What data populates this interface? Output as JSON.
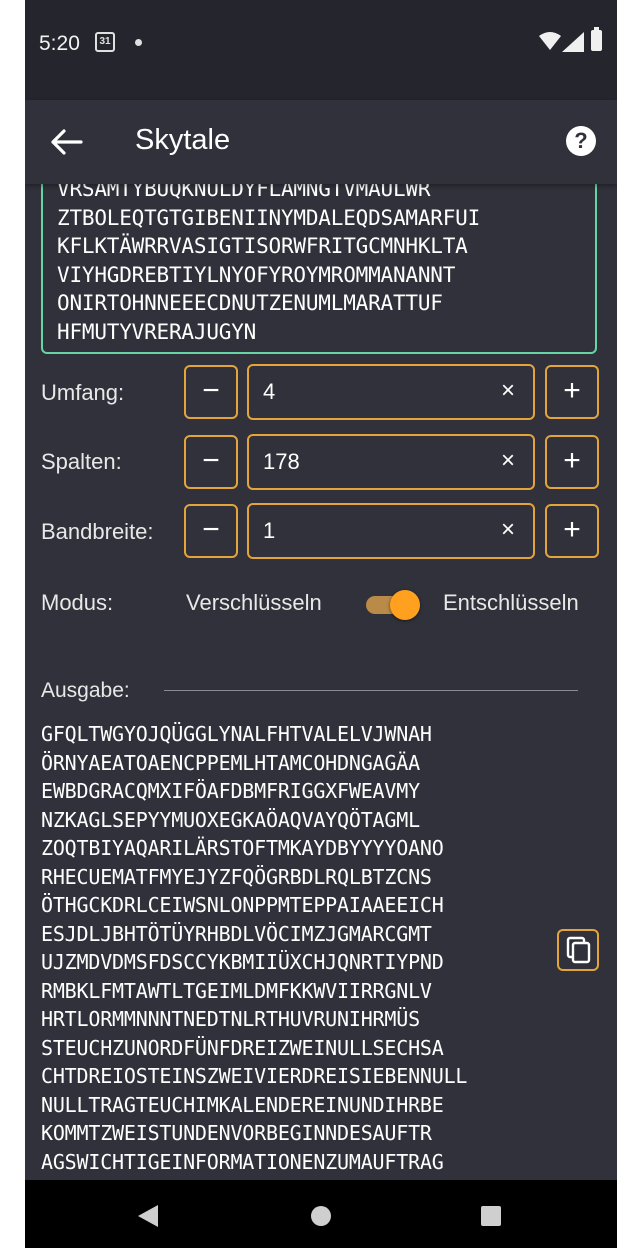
{
  "status": {
    "time": "5:20",
    "calendar_day": "31"
  },
  "appbar": {
    "title": "Skytale"
  },
  "input": {
    "lines": [
      "VRSAMTYBUQKNULDYFLAMNGTVMAULWR",
      "ZTBOLEQTGTGIBENIINYMDALEQDSAMARFUI",
      "KFLKTÄWRRVASIGTISORWFRITGCMNHKLTA",
      "VIYHGDREBTIYLNYOFYROYMROMMANANNT",
      "ONIRTOHNNEEECDNUTZENUMLMARATTUF",
      "HFMUTYVRERAJUGYN"
    ]
  },
  "umfang": {
    "label": "Umfang:",
    "value": "4"
  },
  "spalten": {
    "label": "Spalten:",
    "value": "178"
  },
  "bandbreite": {
    "label": "Bandbreite:",
    "value": "1"
  },
  "controls": {
    "minus": "−",
    "plus": "+",
    "clear": "×"
  },
  "mode": {
    "label": "Modus:",
    "left_option": "Verschlüsseln",
    "right_option": "Entschlüsseln",
    "checked": true
  },
  "output": {
    "label": "Ausgabe:",
    "lines": [
      "GFQLTWGYOJQÜGGLYNALFHTVALELVJWNAH",
      "ÖRNYAEATOAENCPPEMLHTAMCOHDNGAGÄA",
      "EWBDGRACQMXIFÖAFDBMFRIGGXFWEAVMY",
      "NZKAGLSEPYYMUOXEGKAÖAQVAYQÖTAGML",
      "ZOQTBIYAQARILÄRSTOFTMKAYDBYYYYOANO",
      "RHECUEMATFMYEJYZFQÖGRBDLRQLBTZCNS",
      "ÖTHGCKDRLCEIWSNLONPPMTEPPAIAAEEICH",
      "ESJDLJBHTÖTÜYRHBDLVÖCIMZJGMARCGMT",
      "UJZMDVDMSFDSCCYKBMIIÜXCHJQNRTIYPND",
      "RMBKLFMTAWTLTGEIMLDMFKKWVIIRRGNLV",
      "HRTLORMMNNNTNEDTNLRTHUVRUNIHRMÜS",
      "STEUCHZUNORDFÜNFDREIZWEINULLSECHSA",
      "CHTDREIOSTEINSZWEIVIERDREISIEBENNULL",
      "NULLTRAGTEUCHIMKALENDEREINUNDIHRBE",
      "KOMMTZWEISTUNDENVORBEGINNDESAUFTR",
      "AGSWICHTIGEINFORMATIONENZUMAUFTRAG"
    ]
  },
  "colors": {
    "accent": "#e3a43a",
    "input_border": "#66d4a4",
    "background": "#30313a"
  }
}
